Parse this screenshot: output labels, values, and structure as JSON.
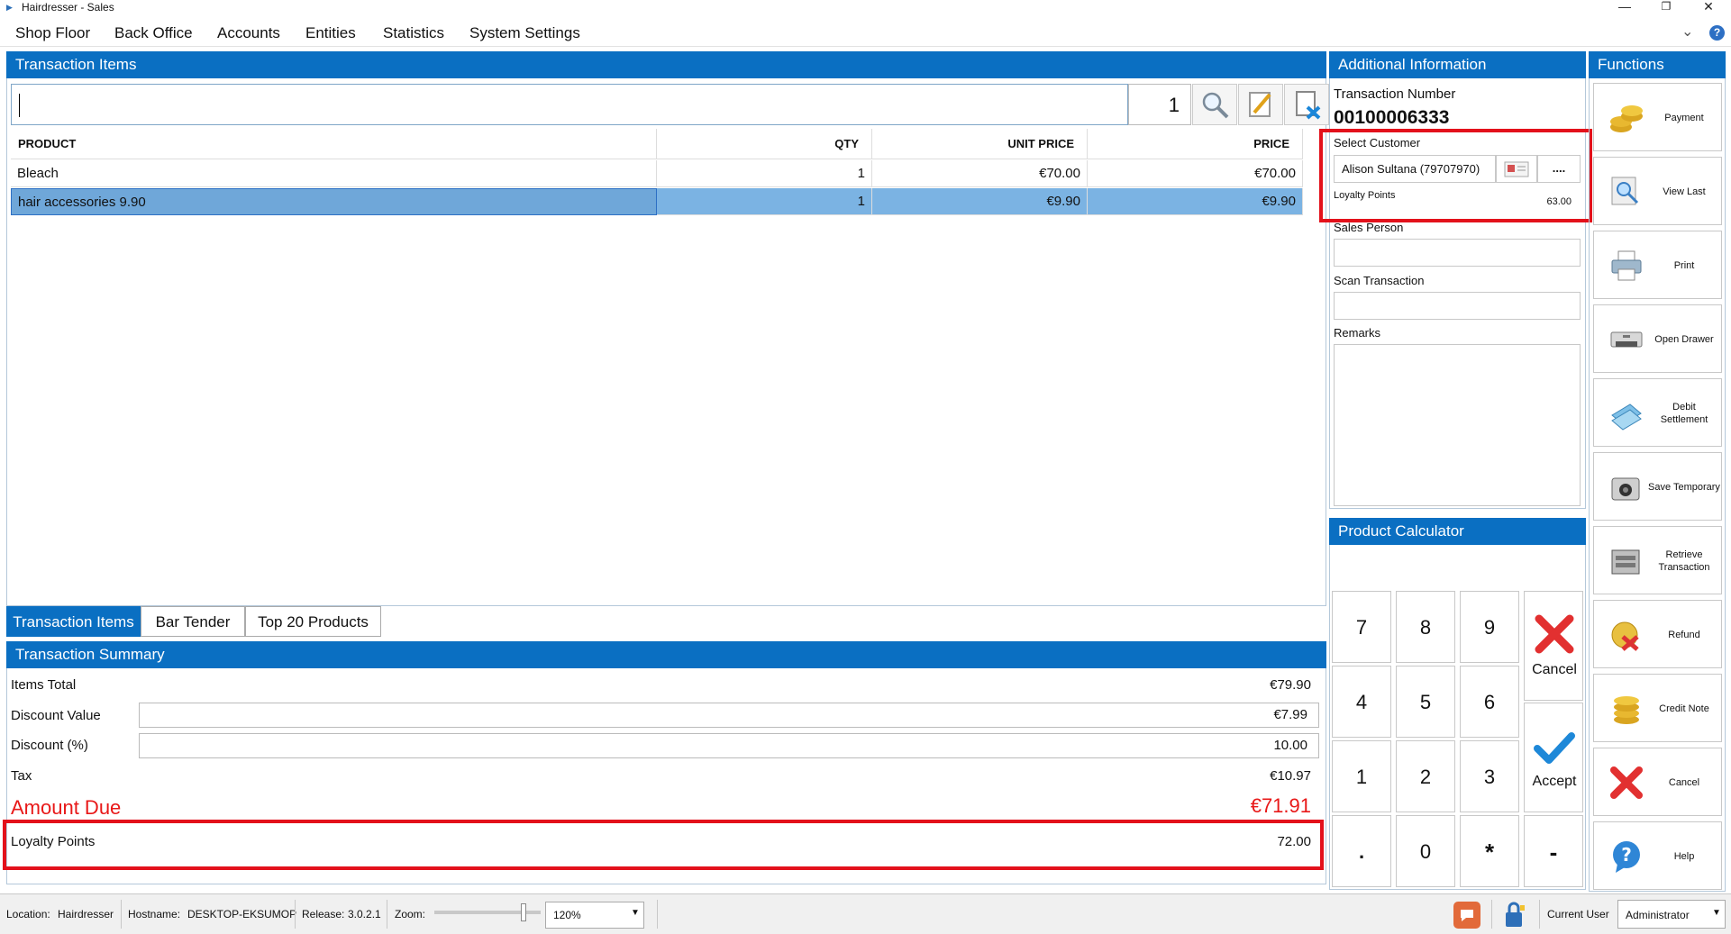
{
  "window": {
    "title": "Hairdresser - Sales"
  },
  "menu": [
    "Shop Floor",
    "Back Office",
    "Accounts",
    "Entities",
    "Statistics",
    "System Settings"
  ],
  "transaction_items": {
    "header": "Transaction Items",
    "qty_input": "1",
    "columns": {
      "product": "PRODUCT",
      "qty": "QTY",
      "unit_price": "UNIT PRICE",
      "price": "PRICE"
    },
    "rows": [
      {
        "product": "Bleach",
        "qty": "1",
        "unit_price": "€70.00",
        "price": "€70.00"
      },
      {
        "product": "hair accessories 9.90",
        "qty": "1",
        "unit_price": "€9.90",
        "price": "€9.90"
      }
    ]
  },
  "tabs": [
    "Transaction Items",
    "Bar Tender",
    "Top 20 Products"
  ],
  "summary": {
    "header": "Transaction Summary",
    "items_total_label": "Items Total",
    "items_total": "€79.90",
    "discount_value_label": "Discount Value",
    "discount_value": "€7.99",
    "discount_pct_label": "Discount (%)",
    "discount_pct": "10.00",
    "tax_label": "Tax",
    "tax": "€10.97",
    "amount_due_label": "Amount Due",
    "amount_due": "€71.91",
    "loyalty_label": "Loyalty Points",
    "loyalty": "72.00"
  },
  "additional": {
    "header": "Additional Information",
    "txn_number_label": "Transaction Number",
    "txn_number": "00100006333",
    "select_customer_label": "Select Customer",
    "customer": "Alison Sultana (79707970)",
    "more": "....",
    "loyalty_label": "Loyalty Points",
    "loyalty": "63.00",
    "sales_person_label": "Sales Person",
    "scan_txn_label": "Scan Transaction",
    "remarks_label": "Remarks"
  },
  "calculator": {
    "header": "Product Calculator",
    "keys": [
      "7",
      "8",
      "9",
      "4",
      "5",
      "6",
      "1",
      "2",
      "3",
      ".",
      "0",
      "*",
      "-"
    ],
    "cancel": "Cancel",
    "accept": "Accept"
  },
  "functions": {
    "header": "Functions",
    "buttons": [
      "Payment",
      "View Last",
      "Print",
      "Open Drawer",
      "Debit Settlement",
      "Save Temporary",
      "Retrieve Transaction",
      "Refund",
      "Credit Note",
      "Cancel",
      "Help"
    ]
  },
  "status": {
    "location_label": "Location:",
    "location": "Hairdresser",
    "hostname_label": "Hostname:",
    "hostname": "DESKTOP-EKSUMOP",
    "release_label": "Release:",
    "release": "3.0.2.1",
    "zoom_label": "Zoom:",
    "zoom": "120%",
    "current_user_label": "Current User",
    "current_user": "Administrator"
  },
  "colors": {
    "accent": "#0a6fc2",
    "selected_row": "#7bb3e3",
    "alert": "#e81818",
    "highlight_box": "#e3111b"
  }
}
